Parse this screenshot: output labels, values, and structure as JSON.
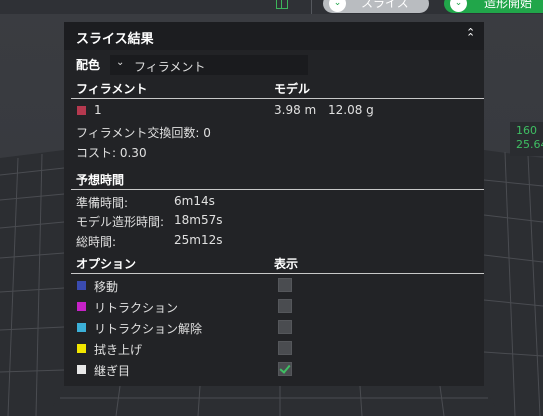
{
  "toolbar": {
    "slice_label": "スライス",
    "print_label": "造形開始"
  },
  "readout": {
    "line1": "160",
    "line2": "25.64"
  },
  "panel": {
    "title": "スライス結果",
    "color_label": "配色",
    "color_value": "フィラメント",
    "col_filament": "フィラメント",
    "col_model": "モデル",
    "filaments": [
      {
        "id": "1",
        "length": "3.98 m",
        "weight": "12.08 g",
        "color": "#b5394f"
      }
    ],
    "filament_changes": "フィラメント交換回数:  0",
    "cost": "コスト:  0.30",
    "estimate_header": "予想時間",
    "prep_label": "準備時間:",
    "prep_value": "6m14s",
    "model_time_label": "モデル造形時間:",
    "model_time_value": "18m57s",
    "total_label": "総時間:",
    "total_value": "25m12s",
    "options_header": "オプション",
    "display_header": "表示",
    "options": [
      {
        "label": "移動",
        "color": "#3a4bb0",
        "checked": false
      },
      {
        "label": "リトラクション",
        "color": "#c722c8",
        "checked": false
      },
      {
        "label": "リトラクション解除",
        "color": "#3cb0d8",
        "checked": false
      },
      {
        "label": "拭き上げ",
        "color": "#f2e600",
        "checked": false
      },
      {
        "label": "継ぎ目",
        "color": "#e8e8e8",
        "checked": true
      }
    ]
  }
}
